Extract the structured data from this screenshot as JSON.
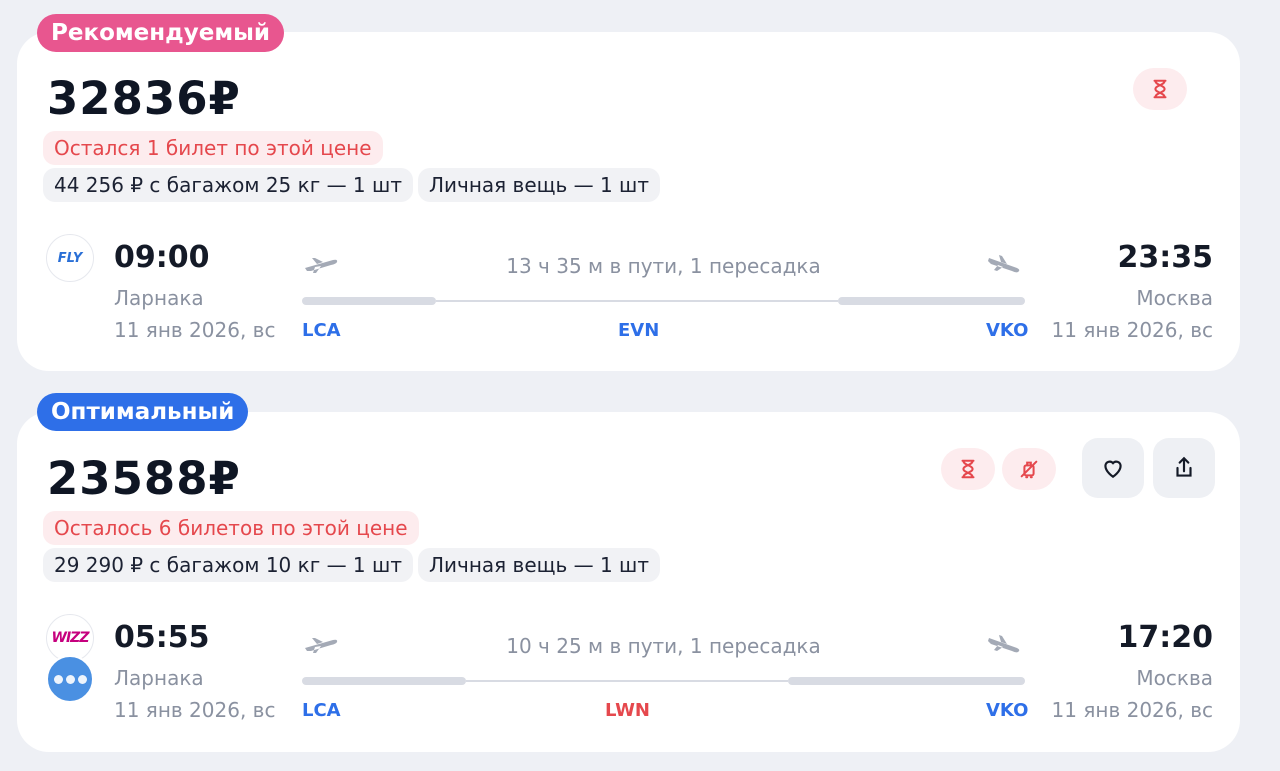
{
  "colors": {
    "recommended_tag": "#e8568f",
    "optimal_tag": "#2e6fe8",
    "warning_text": "#e5484d",
    "airport_code": "#2e6fe8",
    "transfer_code_alert": "#e5484d"
  },
  "offers": [
    {
      "tag": "Рекомендуемый",
      "price": "32836₽",
      "warning": "Остался 1 билет по этой цене",
      "baggage_option": "44 256 ₽ с багажом 25 кг — 1 шт",
      "personal_item": "Личная вещь — 1 шт",
      "icons": [
        "hourglass-icon"
      ],
      "airline_logo": "FLY",
      "departure": {
        "time": "09:00",
        "city": "Ларнака",
        "date": "11 янв 2026, вс",
        "code": "LCA"
      },
      "arrival": {
        "time": "23:35",
        "city": "Москва",
        "date": "11 янв 2026, вс",
        "code": "VKO"
      },
      "duration": "13 ч 35 м в пути, 1 пересадка",
      "transfer_code": "EVN"
    },
    {
      "tag": "Оптимальный",
      "price": "23588₽",
      "warning": "Осталось 6 билетов по этой цене",
      "baggage_option": "29 290 ₽ с багажом 10 кг — 1 шт",
      "personal_item": "Личная вещь — 1 шт",
      "icons": [
        "hourglass-icon",
        "no-baggage-icon",
        "heart-icon",
        "share-icon"
      ],
      "airline_logo": "WIZZ",
      "departure": {
        "time": "05:55",
        "city": "Ларнака",
        "date": "11 янв 2026, вс",
        "code": "LCA"
      },
      "arrival": {
        "time": "17:20",
        "city": "Москва",
        "date": "11 янв 2026, вс",
        "code": "VKO"
      },
      "duration": "10 ч 25 м в пути, 1 пересадка",
      "transfer_code": "LWN"
    }
  ]
}
